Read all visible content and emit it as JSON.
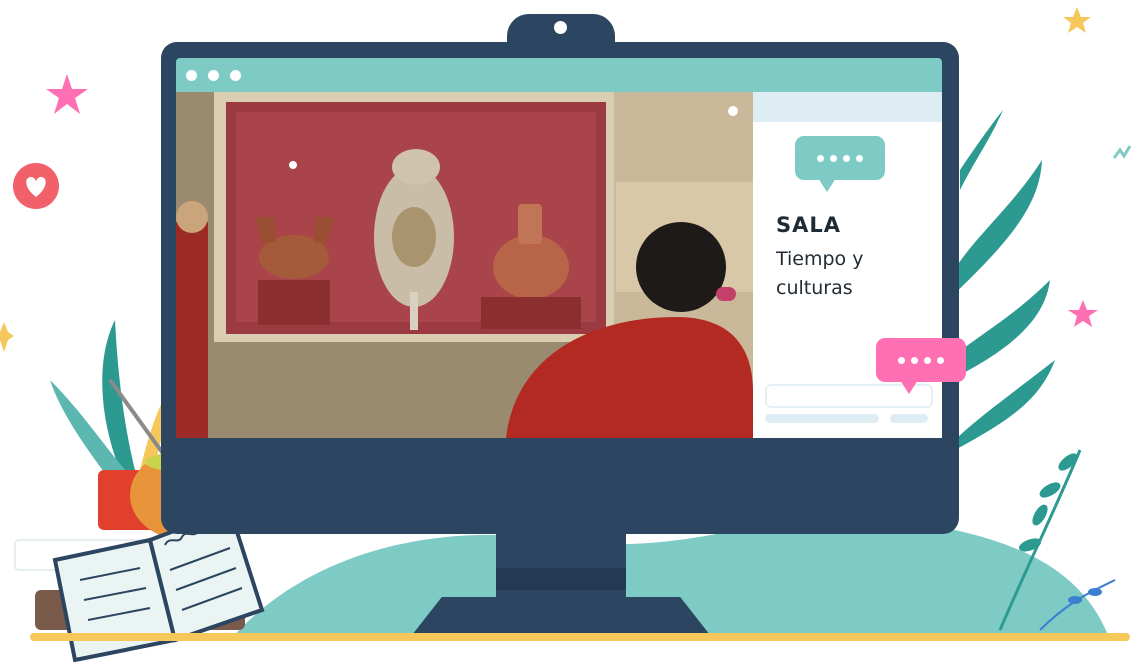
{
  "panel": {
    "heading": "SALA",
    "subtitle_line1": "Tiempo y",
    "subtitle_line2": "culturas"
  },
  "icons": {
    "chat": "speech-bubble-icon",
    "heart": "heart-icon",
    "star": "star-icon"
  },
  "colors": {
    "monitor": "#2c4560",
    "accent_teal": "#7ecac5",
    "accent_pink": "#ff6fb3",
    "panel_tint": "#ddedf3",
    "shelf": "#f6c75a"
  }
}
